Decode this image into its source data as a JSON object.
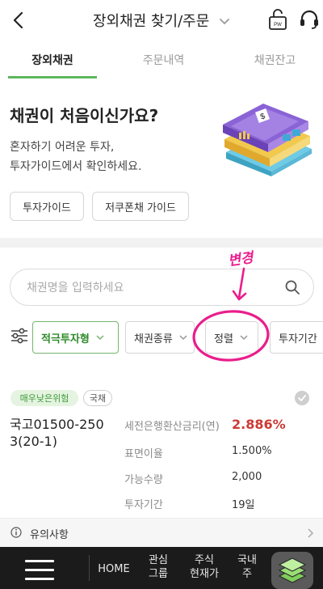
{
  "header": {
    "title": "장외채권 찾기/주문",
    "lock_label": "PW"
  },
  "tabs": [
    {
      "label": "장외채권",
      "active": true
    },
    {
      "label": "주문내역",
      "active": false
    },
    {
      "label": "채권잔고",
      "active": false
    }
  ],
  "intro": {
    "title": "채권이 처음이신가요?",
    "desc_line1": "혼자하기 어려운 투자,",
    "desc_line2": "투자가이드에서 확인하세요.",
    "buttons": [
      "투자가이드",
      "저쿠폰채 가이드"
    ]
  },
  "annotation": {
    "text": "변경",
    "color": "#e91e8c"
  },
  "search": {
    "placeholder": "채권명을 입력하세요"
  },
  "filters": [
    {
      "label": "적극투자형",
      "active": true
    },
    {
      "label": "채권종류",
      "active": false
    },
    {
      "label": "정렬",
      "active": false
    },
    {
      "label": "투자기간",
      "active": false
    }
  ],
  "bond": {
    "risk_badge": "매우낮은위험",
    "type_badge": "국채",
    "name_line1": "국고01500-250",
    "name_line2": "3(20-1)",
    "rows": [
      {
        "label": "세전은행환산금리(연)",
        "value": "2.886%"
      },
      {
        "label": "표면이율",
        "value": "1.500%"
      },
      {
        "label": "가능수량",
        "value": "2,000"
      },
      {
        "label": "투자기간",
        "value": "19일"
      }
    ]
  },
  "notice": {
    "label": "유의사항"
  },
  "bottom_nav": {
    "items": [
      {
        "line1": "HOME",
        "line2": ""
      },
      {
        "line1": "관심",
        "line2": "그룹"
      },
      {
        "line1": "주식",
        "line2": "현재가"
      },
      {
        "line1": "국내",
        "line2": "주"
      }
    ]
  },
  "colors": {
    "accent_green": "#5cb85c",
    "rate_red": "#cc3a35",
    "annotation_pink": "#e91e8c"
  }
}
